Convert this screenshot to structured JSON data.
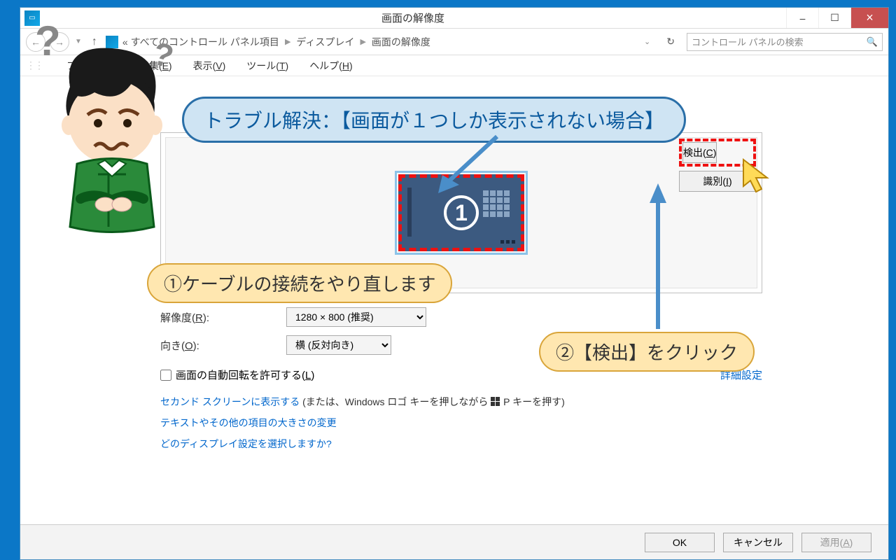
{
  "window": {
    "title": "画面の解像度",
    "minimize": "–",
    "maximize": "☐",
    "close": "×"
  },
  "nav": {
    "back": "←",
    "forward": "→",
    "up": "↑",
    "path1": "« すべてのコントロール パネル項目",
    "path2": "ディスプレイ",
    "path3": "画面の解像度",
    "refresh": "↻",
    "search_placeholder": "コントロール パネルの検索"
  },
  "menu": {
    "file": "ファイル(F)",
    "edit": "編集(E)",
    "view": "表示(V)",
    "tools": "ツール(T)",
    "help": "ヘルプ(H)"
  },
  "monitor_number": "1",
  "buttons": {
    "detect": "検出(C)",
    "identify": "識別(I)"
  },
  "labels": {
    "resolution": "解像度(R):",
    "orientation": "向き(O):",
    "autorotate": "画面の自動回転を許可する(L)",
    "advanced": "詳細設定"
  },
  "values": {
    "resolution": "1280 × 800 (推奨)",
    "orientation": "横 (反対向き)"
  },
  "links": {
    "second_screen": "セカンド スクリーンに表示する",
    "second_screen_plain": " (または、Windows ロゴ キーを押しながら ",
    "second_screen_plain2": " P キーを押す)",
    "text_size": "テキストやその他の項目の大きさの変更",
    "which_display": "どのディスプレイ設定を選択しますか?"
  },
  "footer": {
    "ok": "OK",
    "cancel": "キャンセル",
    "apply": "適用(A)"
  },
  "callouts": {
    "trouble": "トラブル解決：【画面が１つしか表示されない場合】",
    "step1": "①ケーブルの接続をやり直します",
    "step2": "②【検出】をクリック"
  }
}
